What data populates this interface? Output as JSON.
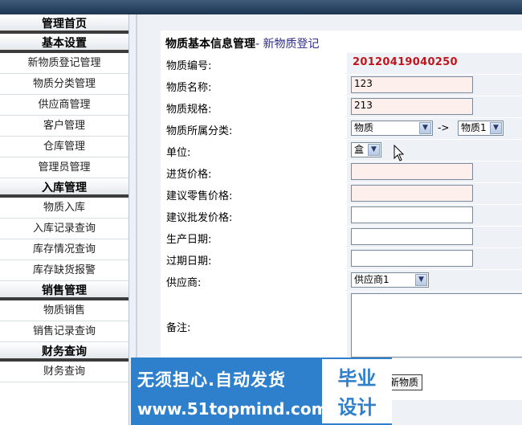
{
  "sidebar": {
    "sections": [
      {
        "head": "管理首页",
        "items": []
      },
      {
        "head": "基本设置",
        "items": [
          "新物质登记管理",
          "物质分类管理",
          "供应商管理",
          "客户管理",
          "仓库管理",
          "管理员管理"
        ]
      },
      {
        "head": "入库管理",
        "items": [
          "物质入库",
          "入库记录查询",
          "库存情况查询",
          "库存缺货报警"
        ]
      },
      {
        "head": "销售管理",
        "items": [
          "物质销售",
          "销售记录查询"
        ]
      },
      {
        "head": "财务查询",
        "items": [
          "财务查询"
        ]
      }
    ]
  },
  "form": {
    "title_main": "物质基本信息管理",
    "title_sep": "- ",
    "title_sub": "新物质登记",
    "fields": {
      "code": {
        "label": "物质编号:",
        "value": "20120419040250"
      },
      "name": {
        "label": "物质名称:",
        "value": "123"
      },
      "spec": {
        "label": "物质规格:",
        "value": "213"
      },
      "category": {
        "label": "物质所属分类:",
        "main": "物质",
        "arrow": "->",
        "sub": "物质1"
      },
      "unit": {
        "label": "单位:",
        "value": "盒"
      },
      "purchase_price": {
        "label": "进货价格:",
        "value": ""
      },
      "retail_price": {
        "label": "建议零售价格:",
        "value": ""
      },
      "wholesale_price": {
        "label": "建议批发价格:",
        "value": ""
      },
      "production_date": {
        "label": "生产日期:",
        "value": ""
      },
      "expiry_date": {
        "label": "过期日期:",
        "value": ""
      },
      "supplier": {
        "label": "供应商:",
        "value": "供应商1"
      },
      "remark": {
        "label": "备注:",
        "value": ""
      }
    },
    "submit_label": "新物质"
  },
  "banner": {
    "line1": "无须担心.自动发货",
    "line2": "www.51topmind.com",
    "logo_line1": "毕业",
    "logo_line2": "设计"
  }
}
